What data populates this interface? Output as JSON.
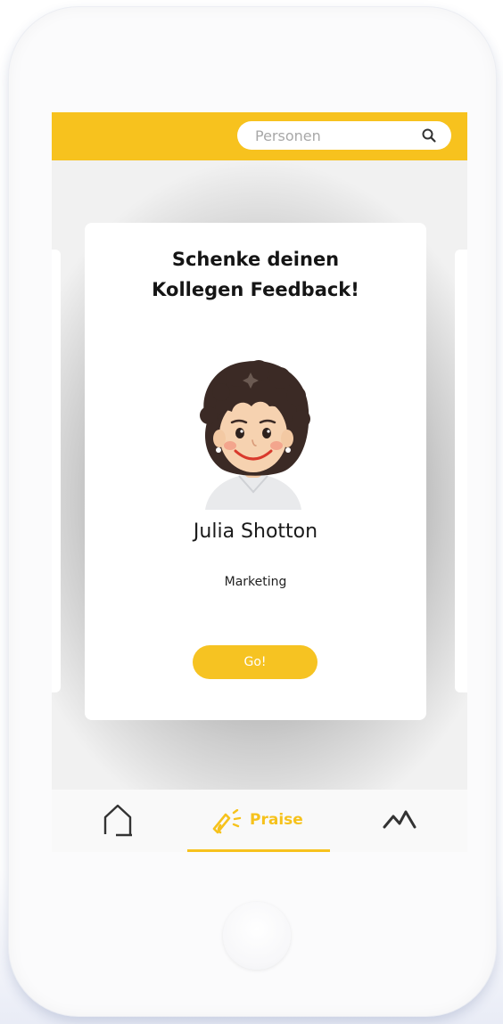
{
  "search": {
    "placeholder": "Personen",
    "icon": "search-icon"
  },
  "card": {
    "title_line1": "Schenke deinen",
    "title_line2": "Kollegen Feedback!",
    "person": {
      "name": "Julia Shotton",
      "department": "Marketing"
    },
    "go_label": "Go!"
  },
  "nav": {
    "items": [
      {
        "icon": "home-icon",
        "label": ""
      },
      {
        "icon": "megaphone-icon",
        "label": "Praise",
        "active": true
      },
      {
        "icon": "stats-icon",
        "label": ""
      }
    ]
  },
  "colors": {
    "accent": "#f7c21e",
    "button_text": "#ffffff"
  }
}
